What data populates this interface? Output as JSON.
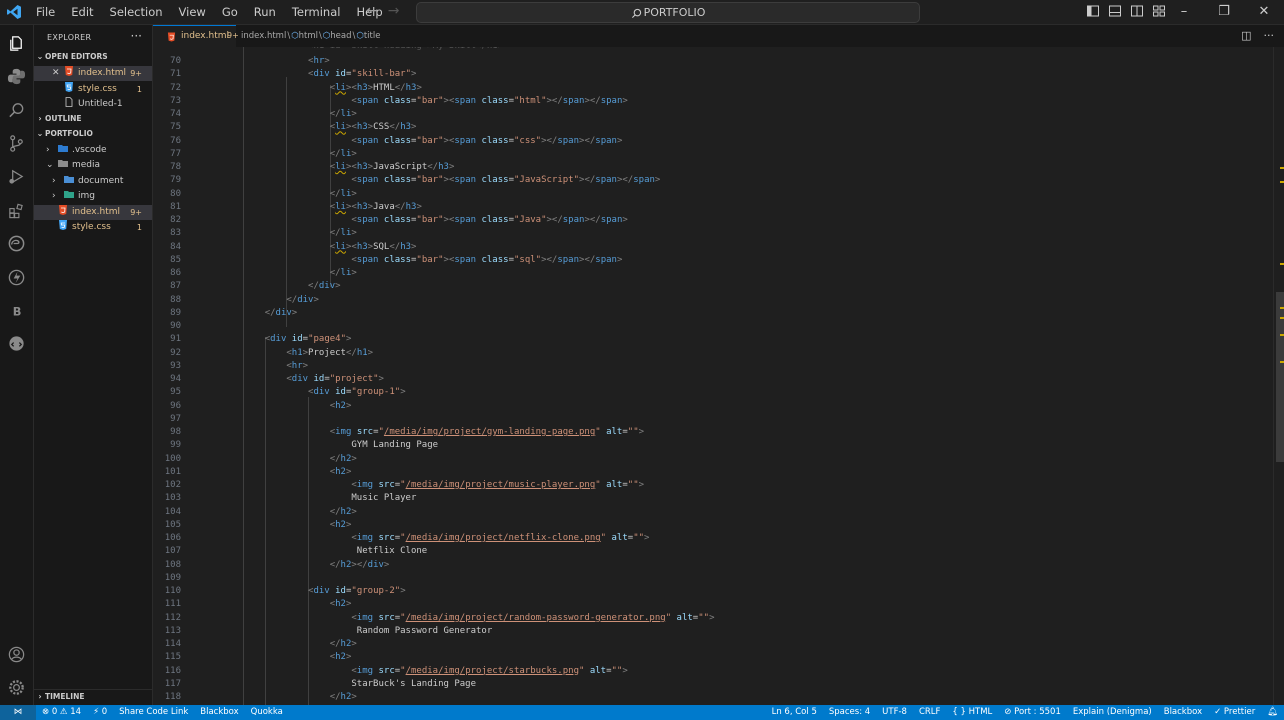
{
  "menu": [
    "File",
    "Edit",
    "Selection",
    "View",
    "Go",
    "Run",
    "Terminal",
    "Help"
  ],
  "command_center": "PORTFOLIO",
  "explorer": {
    "title": "EXPLORER",
    "open_editors_label": "OPEN EDITORS",
    "open_editors": [
      {
        "name": "index.html",
        "badge": "9+"
      },
      {
        "name": "style.css",
        "badge": "1"
      },
      {
        "name": "Untitled-1",
        "badge": ""
      }
    ],
    "outline_label": "OUTLINE",
    "folder_label": "PORTFOLIO",
    "tree": [
      {
        "name": ".vscode",
        "badge": ""
      },
      {
        "name": "media",
        "badge": ""
      },
      {
        "name": "document",
        "badge": ""
      },
      {
        "name": "img",
        "badge": ""
      },
      {
        "name": "index.html",
        "badge": "9+"
      },
      {
        "name": "style.css",
        "badge": "1"
      }
    ],
    "timeline_label": "TIMELINE"
  },
  "tab": {
    "name": "index.html",
    "badge": "9+"
  },
  "breadcrumb": [
    "index.html",
    "html",
    "head",
    "title"
  ],
  "editor": {
    "lines": [
      {
        "n": "70",
        "t": "            <hr>"
      },
      {
        "n": "71",
        "t": "            <div id=\"skill-bar\">"
      },
      {
        "n": "72",
        "t": "                <li><h3>HTML</h3>"
      },
      {
        "n": "73",
        "t": "                    <span class=\"bar\"><span class=\"html\"></span></span>"
      },
      {
        "n": "74",
        "t": "                </li>"
      },
      {
        "n": "75",
        "t": "                <li><h3>CSS</h3>"
      },
      {
        "n": "76",
        "t": "                    <span class=\"bar\"><span class=\"css\"></span></span>"
      },
      {
        "n": "77",
        "t": "                </li>"
      },
      {
        "n": "78",
        "t": "                <li><h3>JavaScript</h3>"
      },
      {
        "n": "79",
        "t": "                    <span class=\"bar\"><span class=\"JavaScript\"></span></span>"
      },
      {
        "n": "80",
        "t": "                </li>"
      },
      {
        "n": "81",
        "t": "                <li><h3>Java</h3>"
      },
      {
        "n": "82",
        "t": "                    <span class=\"bar\"><span class=\"Java\"></span></span>"
      },
      {
        "n": "83",
        "t": "                </li>"
      },
      {
        "n": "84",
        "t": "                <li><h3>SQL</h3>"
      },
      {
        "n": "85",
        "t": "                    <span class=\"bar\"><span class=\"sql\"></span></span>"
      },
      {
        "n": "86",
        "t": "                </li>"
      },
      {
        "n": "87",
        "t": "            </div>"
      },
      {
        "n": "88",
        "t": "        </div>"
      },
      {
        "n": "89",
        "t": "    </div>"
      },
      {
        "n": "90",
        "t": ""
      },
      {
        "n": "91",
        "t": "    <div id=\"page4\">"
      },
      {
        "n": "92",
        "t": "        <h1>Project</h1>"
      },
      {
        "n": "93",
        "t": "        <hr>"
      },
      {
        "n": "94",
        "t": "        <div id=\"project\">"
      },
      {
        "n": "95",
        "t": "            <div id=\"group-1\">"
      },
      {
        "n": "96",
        "t": "                <h2>"
      },
      {
        "n": "97",
        "t": ""
      },
      {
        "n": "98",
        "t": "                <img src=\"/media/img/project/gym-landing-page.png\" alt=\"\">"
      },
      {
        "n": "99",
        "t": "                    GYM Landing Page"
      },
      {
        "n": "100",
        "t": "                </h2>"
      },
      {
        "n": "101",
        "t": "                <h2>"
      },
      {
        "n": "102",
        "t": "                    <img src=\"/media/img/project/music-player.png\" alt=\"\">"
      },
      {
        "n": "103",
        "t": "                    Music Player"
      },
      {
        "n": "104",
        "t": "                </h2>"
      },
      {
        "n": "105",
        "t": "                <h2>"
      },
      {
        "n": "106",
        "t": "                    <img src=\"/media/img/project/netflix-clone.png\" alt=\"\">"
      },
      {
        "n": "107",
        "t": "                     Netflix Clone"
      },
      {
        "n": "108",
        "t": "                </h2></div>"
      },
      {
        "n": "109",
        "t": ""
      },
      {
        "n": "110",
        "t": "            <div id=\"group-2\">"
      },
      {
        "n": "111",
        "t": "                <h2>"
      },
      {
        "n": "112",
        "t": "                    <img src=\"/media/img/project/random-password-generator.png\" alt=\"\">"
      },
      {
        "n": "113",
        "t": "                     Random Password Generator"
      },
      {
        "n": "114",
        "t": "                </h2>"
      },
      {
        "n": "115",
        "t": "                <h2>"
      },
      {
        "n": "116",
        "t": "                    <img src=\"/media/img/project/starbucks.png\" alt=\"\">"
      },
      {
        "n": "117",
        "t": "                    StarBuck's Landing Page"
      },
      {
        "n": "118",
        "t": "                </h2>"
      }
    ]
  },
  "status": {
    "left": [
      "⊗ 0 ⚠ 14",
      "⚡ 0",
      "Share Code Link",
      "Blackbox",
      "Quokka"
    ],
    "right": [
      "Ln 6, Col 5",
      "Spaces: 4",
      "UTF-8",
      "CRLF",
      "{ } HTML",
      "⊘ Port : 5501",
      "Explain (Denigma)",
      "Blackbox",
      "✓ Prettier"
    ]
  },
  "colors": {
    "accent": "#007acc",
    "modified": "#e2c08d",
    "html_icon": "#e44d26",
    "css_icon": "#42a5f5"
  }
}
